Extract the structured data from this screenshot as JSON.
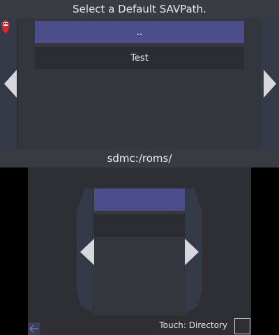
{
  "top": {
    "title": "Select a Default SAVPath.",
    "list": [
      {
        "label": "..",
        "selected": true
      },
      {
        "label": "Test",
        "selected": false
      }
    ],
    "path": "sdmc:/roms/"
  },
  "bottom": {
    "touch_label": "Touch: Directory"
  },
  "colors": {
    "background": "#2d2f35",
    "selected_item": "#4c4e8c",
    "item": "#2b2d32",
    "side_panel": "#343a48",
    "arrow": "#d8d8dc"
  },
  "icons": {
    "left_arrow": "triangle-left",
    "right_arrow": "triangle-right",
    "back": "back-arrow-icon",
    "mascot": "red-character-icon"
  }
}
